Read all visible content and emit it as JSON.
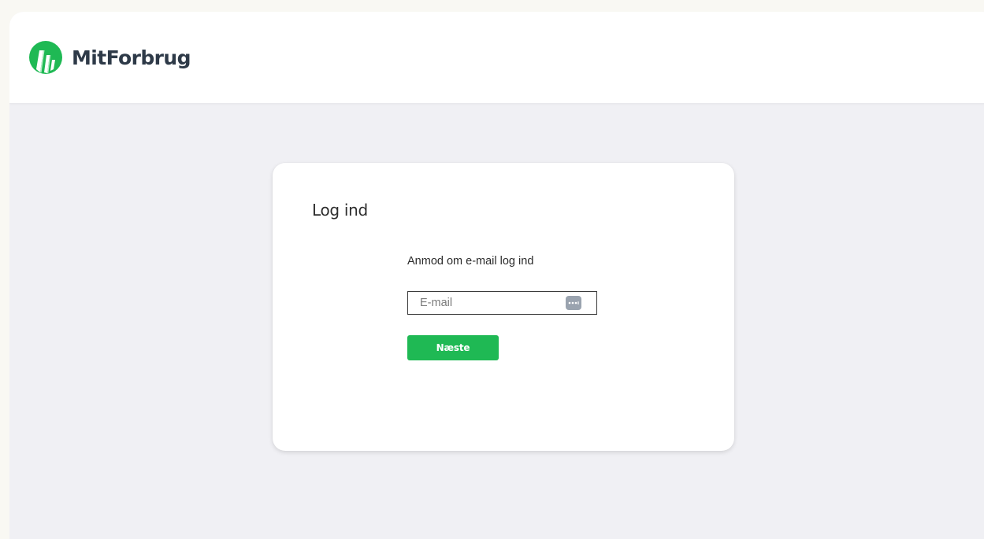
{
  "header": {
    "brand_name": "MitForbrug",
    "logo_icon": "mitforbrug-logo-icon"
  },
  "login": {
    "title": "Log ind",
    "subtitle": "Anmod om e-mail log ind",
    "email_placeholder": "E-mail",
    "email_value": "",
    "password_manager_icon": "password-manager-icon",
    "next_label": "Næste"
  },
  "colors": {
    "accent": "#1fb954",
    "brand_text": "#2e3a48",
    "page_background": "#f0f0f4",
    "card_background": "#ffffff"
  }
}
